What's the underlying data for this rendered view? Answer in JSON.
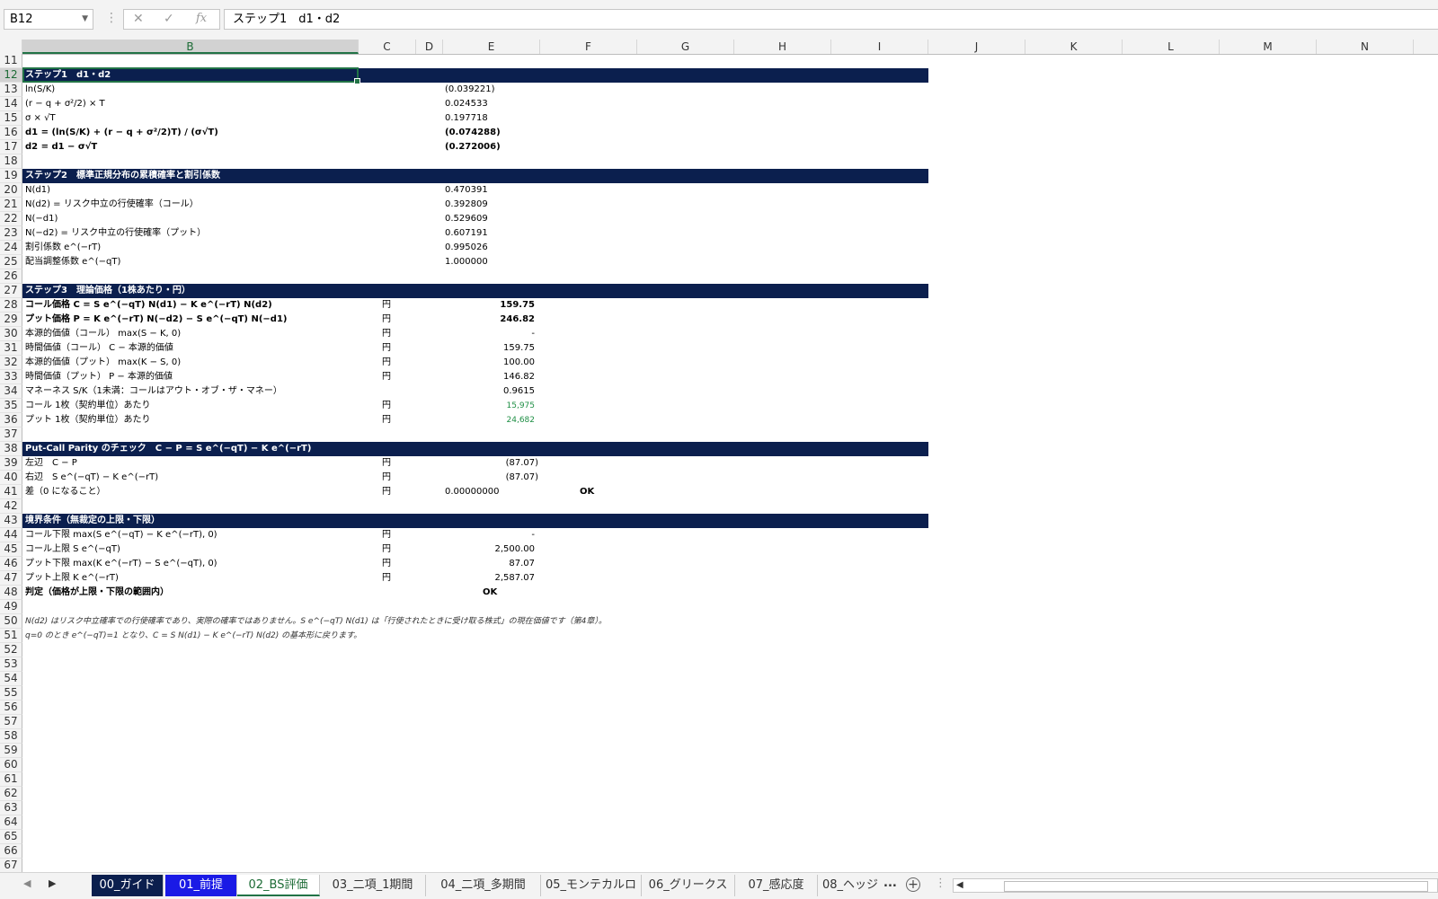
{
  "formula_bar": {
    "name_box": "B12",
    "cancel": "✕",
    "enter": "✓",
    "fx": "fx",
    "content": "ステップ1　d1・d2"
  },
  "columns": [
    "B",
    "C",
    "D",
    "E",
    "F",
    "G",
    "H",
    "I",
    "J",
    "K",
    "L",
    "M",
    "N"
  ],
  "rows": {
    "r11": "",
    "r12": "ステップ1　d1・d2",
    "r13_label": "ln(S/K)",
    "r13_val": "(0.039221)",
    "r14_label": "(r − q + σ²/2) × T",
    "r14_val": "0.024533",
    "r15_label": "σ × √T",
    "r15_val": "0.197718",
    "r16_label": "d1 = (ln(S/K) + (r − q + σ²/2)T) / (σ√T)",
    "r16_val": "(0.074288)",
    "r17_label": "d2 = d1 − σ√T",
    "r17_val": "(0.272006)",
    "r19": "ステップ2　標準正規分布の累積確率と割引係数",
    "r20_label": "N(d1)",
    "r20_val": "0.470391",
    "r21_label": "N(d2) = リスク中立の行使確率（コール）",
    "r21_val": "0.392809",
    "r22_label": "N(−d1)",
    "r22_val": "0.529609",
    "r23_label": "N(−d2) = リスク中立の行使確率（プット）",
    "r23_val": "0.607191",
    "r24_label": "割引係数 e^(−rT)",
    "r24_val": "0.995026",
    "r25_label": "配当調整係数 e^(−qT)",
    "r25_val": "1.000000",
    "r27": "ステップ3　理論価格（1株あたり・円）",
    "r28_label": "コール価格 C = S e^(−qT) N(d1) − K e^(−rT) N(d2)",
    "r28_val": "159.75",
    "r29_label": "プット価格 P = K e^(−rT) N(−d2) − S e^(−qT) N(−d1)",
    "r29_val": "246.82",
    "r30_label": "本源的価値（コール） max(S − K, 0)",
    "r30_val": "-",
    "r31_label": "時間価値（コール） C − 本源的価値",
    "r31_val": "159.75",
    "r32_label": "本源的価値（プット） max(K − S, 0)",
    "r32_val": "100.00",
    "r33_label": "時間価値（プット） P − 本源的価値",
    "r33_val": "146.82",
    "r34_label": "マネーネス S/K（1未満：コールはアウト・オブ・ザ・マネー）",
    "r34_val": "0.9615",
    "r35_label": "コール 1枚（契約単位）あたり",
    "r35_val": "15,975",
    "r36_label": "プット 1枚（契約単位）あたり",
    "r36_val": "24,682",
    "r38": "Put-Call Parity のチェック　C − P = S e^(−qT) − K e^(−rT)",
    "r39_label": "左辺　C − P",
    "r39_val": "(87.07)",
    "r40_label": "右辺　S e^(−qT) − K e^(−rT)",
    "r40_val": "(87.07)",
    "r41_label": "差（0 になること）",
    "r41_val": "0.00000000",
    "r41_ok": "OK",
    "r43": "境界条件（無裁定の上限・下限）",
    "r44_label": "コール下限 max(S e^(−qT) − K e^(−rT), 0)",
    "r44_val": "-",
    "r45_label": "コール上限 S e^(−qT)",
    "r45_val": "2,500.00",
    "r46_label": "プット下限 max(K e^(−rT) − S e^(−qT), 0)",
    "r46_val": "87.07",
    "r47_label": "プット上限 K e^(−rT)",
    "r47_val": "2,587.07",
    "r48_label": "判定（価格が上限・下限の範囲内）",
    "r48_ok": "OK",
    "r50": "N(d2) はリスク中立確率での行使確率であり、実際の確率ではありません。S e^(−qT) N(d1) は「行使されたときに受け取る株式」の現在価値です（第4章）。",
    "r51": "q=0 のとき e^(−qT)=1 となり、C = S N(d1) − K e^(−rT) N(d2) の基本形に戻ります。",
    "yen": "円"
  },
  "sheet_tabs": [
    "00_ガイド",
    "01_前提",
    "02_BS評価",
    "03_二項_1期間",
    "04_二項_多期間",
    "05_モンテカルロ",
    "06_グリークス",
    "07_感応度",
    "08_ヘッジ"
  ],
  "active_tab": "02_BS評価",
  "more_tabs": "...",
  "colors": {
    "header_navy": "#0b1f4e",
    "tab_blue": "#1a1ae6",
    "excel_green": "#217346",
    "value_green": "#1f8f45"
  }
}
